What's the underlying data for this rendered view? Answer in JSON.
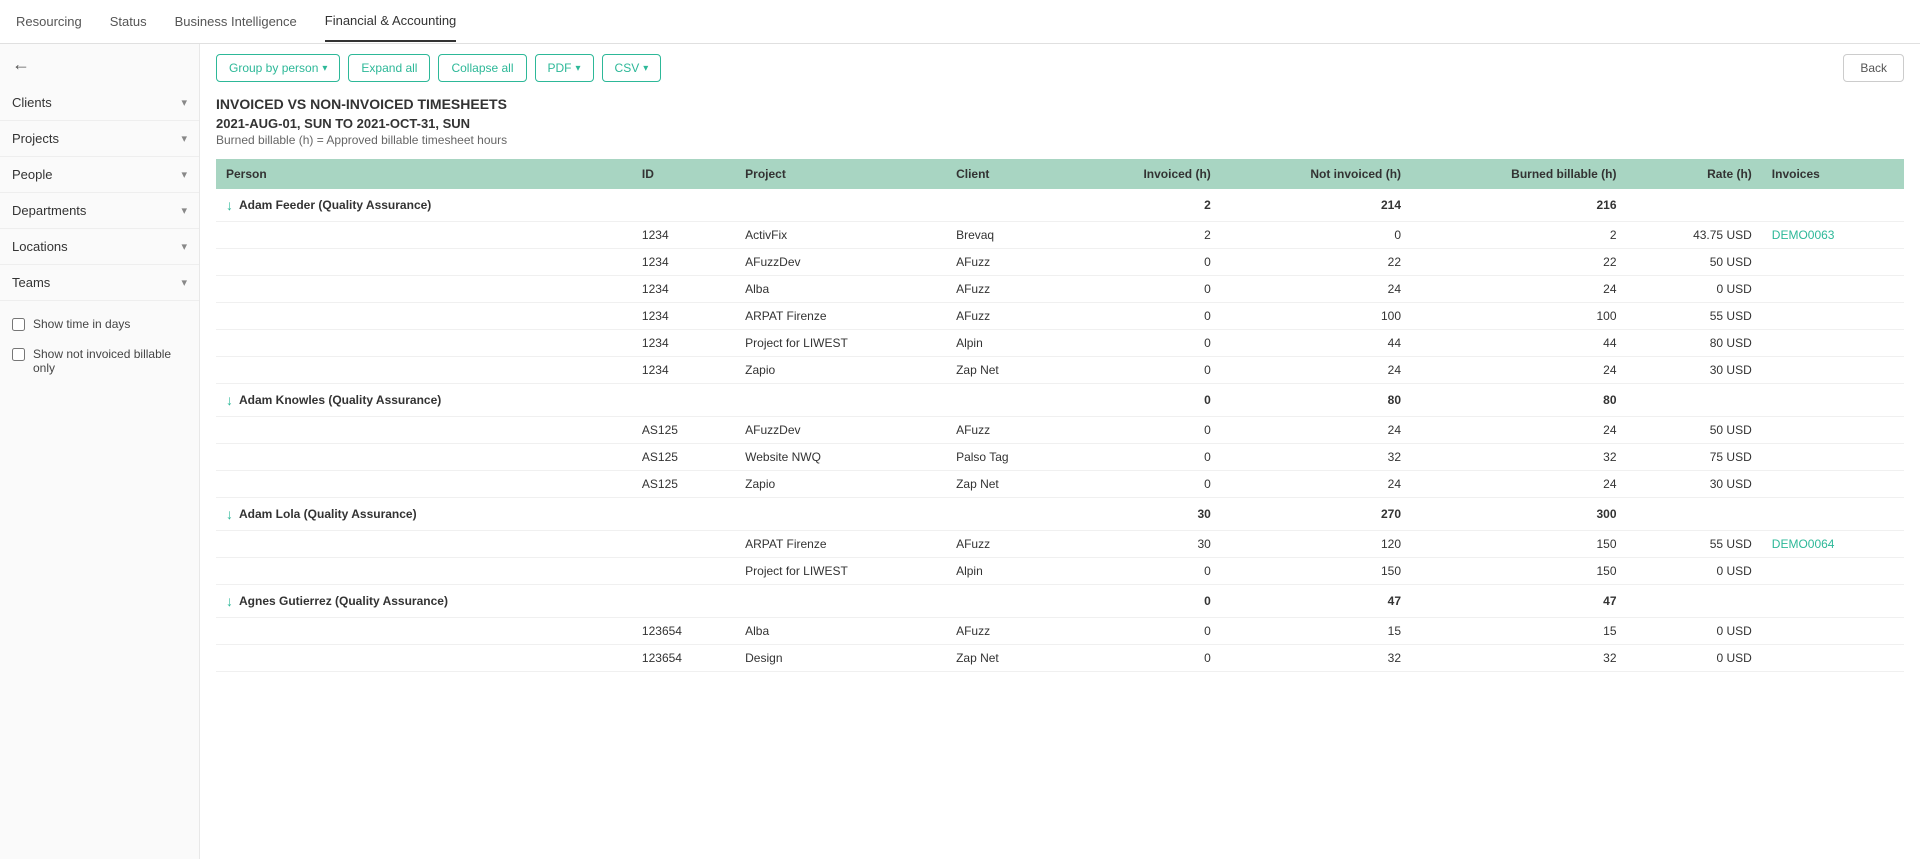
{
  "nav": {
    "items": [
      {
        "label": "Resourcing",
        "active": false
      },
      {
        "label": "Status",
        "active": false
      },
      {
        "label": "Business Intelligence",
        "active": false
      },
      {
        "label": "Financial & Accounting",
        "active": true
      }
    ]
  },
  "sidebar": {
    "back_icon": "←",
    "filters": [
      {
        "label": "Clients",
        "id": "clients"
      },
      {
        "label": "Projects",
        "id": "projects"
      },
      {
        "label": "People",
        "id": "people"
      },
      {
        "label": "Departments",
        "id": "departments"
      },
      {
        "label": "Locations",
        "id": "locations"
      },
      {
        "label": "Teams",
        "id": "teams"
      }
    ],
    "checkboxes": [
      {
        "label": "Show time in days",
        "id": "show-time-days",
        "checked": false
      },
      {
        "label": "Show not invoiced billable only",
        "id": "show-not-invoiced",
        "checked": false
      }
    ]
  },
  "toolbar": {
    "group_by_label": "Group by person",
    "expand_all_label": "Expand all",
    "collapse_all_label": "Collapse all",
    "pdf_label": "PDF",
    "csv_label": "CSV",
    "back_label": "Back"
  },
  "report": {
    "title": "INVOICED VS NON-INVOICED TIMESHEETS",
    "dates": "2021-AUG-01, SUN TO 2021-OCT-31, SUN",
    "note": "Burned billable (h) = Approved billable timesheet hours"
  },
  "table": {
    "columns": [
      "Person",
      "ID",
      "Project",
      "Client",
      "Invoiced (h)",
      "Not invoiced (h)",
      "Burned billable (h)",
      "Rate (h)",
      "Invoices"
    ],
    "groups": [
      {
        "name": "Adam Feeder (Quality Assurance)",
        "invoiced": "2",
        "not_invoiced": "214",
        "burned": "216",
        "rows": [
          {
            "id": "1234",
            "project": "ActivFix",
            "client": "Brevaq",
            "invoiced": "2",
            "not_invoiced": "0",
            "burned": "2",
            "rate": "43.75 USD",
            "invoice": "DEMO0063"
          },
          {
            "id": "1234",
            "project": "AFuzzDev",
            "client": "AFuzz",
            "invoiced": "0",
            "not_invoiced": "22",
            "burned": "22",
            "rate": "50 USD",
            "invoice": ""
          },
          {
            "id": "1234",
            "project": "Alba",
            "client": "AFuzz",
            "invoiced": "0",
            "not_invoiced": "24",
            "burned": "24",
            "rate": "0 USD",
            "invoice": ""
          },
          {
            "id": "1234",
            "project": "ARPAT Firenze",
            "client": "AFuzz",
            "invoiced": "0",
            "not_invoiced": "100",
            "burned": "100",
            "rate": "55 USD",
            "invoice": ""
          },
          {
            "id": "1234",
            "project": "Project for LIWEST",
            "client": "Alpin",
            "invoiced": "0",
            "not_invoiced": "44",
            "burned": "44",
            "rate": "80 USD",
            "invoice": ""
          },
          {
            "id": "1234",
            "project": "Zapio",
            "client": "Zap Net",
            "invoiced": "0",
            "not_invoiced": "24",
            "burned": "24",
            "rate": "30 USD",
            "invoice": ""
          }
        ]
      },
      {
        "name": "Adam Knowles (Quality Assurance)",
        "invoiced": "0",
        "not_invoiced": "80",
        "burned": "80",
        "rows": [
          {
            "id": "AS125",
            "project": "AFuzzDev",
            "client": "AFuzz",
            "invoiced": "0",
            "not_invoiced": "24",
            "burned": "24",
            "rate": "50 USD",
            "invoice": ""
          },
          {
            "id": "AS125",
            "project": "Website NWQ",
            "client": "Palso Tag",
            "invoiced": "0",
            "not_invoiced": "32",
            "burned": "32",
            "rate": "75 USD",
            "invoice": ""
          },
          {
            "id": "AS125",
            "project": "Zapio",
            "client": "Zap Net",
            "invoiced": "0",
            "not_invoiced": "24",
            "burned": "24",
            "rate": "30 USD",
            "invoice": ""
          }
        ]
      },
      {
        "name": "Adam Lola (Quality Assurance)",
        "invoiced": "30",
        "not_invoiced": "270",
        "burned": "300",
        "rows": [
          {
            "id": "",
            "project": "ARPAT Firenze",
            "client": "AFuzz",
            "invoiced": "30",
            "not_invoiced": "120",
            "burned": "150",
            "rate": "55 USD",
            "invoice": "DEMO0064"
          },
          {
            "id": "",
            "project": "Project for LIWEST",
            "client": "Alpin",
            "invoiced": "0",
            "not_invoiced": "150",
            "burned": "150",
            "rate": "0 USD",
            "invoice": ""
          }
        ]
      },
      {
        "name": "Agnes Gutierrez (Quality Assurance)",
        "invoiced": "0",
        "not_invoiced": "47",
        "burned": "47",
        "rows": [
          {
            "id": "123654",
            "project": "Alba",
            "client": "AFuzz",
            "invoiced": "0",
            "not_invoiced": "15",
            "burned": "15",
            "rate": "0 USD",
            "invoice": ""
          },
          {
            "id": "123654",
            "project": "Design",
            "client": "Zap Net",
            "invoiced": "0",
            "not_invoiced": "32",
            "burned": "32",
            "rate": "0 USD",
            "invoice": ""
          }
        ]
      }
    ]
  }
}
